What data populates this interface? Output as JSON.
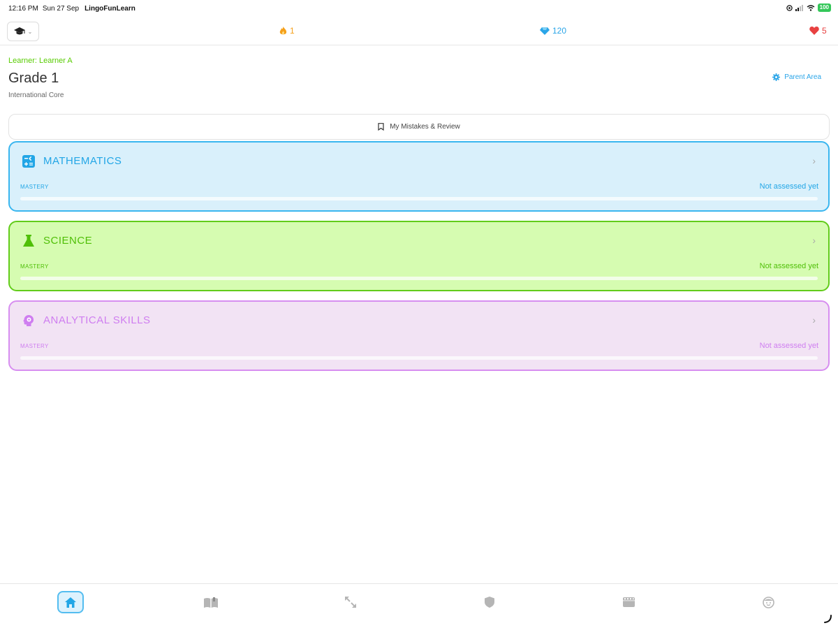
{
  "status_bar": {
    "time": "12:16 PM",
    "date": "Sun 27 Sep",
    "app_name": "LingoFunLearn",
    "battery": "100"
  },
  "top_bar": {
    "grade_icon": "graduation-cap-icon",
    "streak": "1",
    "gems": "120",
    "hearts": "5",
    "colors": {
      "streak": "#f5a01a",
      "gems": "#2aa5e8",
      "hearts": "#e84141"
    }
  },
  "header": {
    "learner": "Learner: Learner A",
    "grade": "Grade 1",
    "curriculum": "International Core",
    "parent_area": "Parent Area"
  },
  "review": {
    "label": "My Mistakes & Review"
  },
  "subjects": [
    {
      "title": "MATHEMATICS",
      "icon": "calculator-icon",
      "mastery_label": "MASTERY",
      "status": "Not assessed yet",
      "mastery_percent": 0,
      "color": "#22a6e6"
    },
    {
      "title": "SCIENCE",
      "icon": "flask-icon",
      "mastery_label": "MASTERY",
      "status": "Not assessed yet",
      "mastery_percent": 0,
      "color": "#4fbf07"
    },
    {
      "title": "ANALYTICAL SKILLS",
      "icon": "brain-head-icon",
      "mastery_label": "MASTERY",
      "status": "Not assessed yet",
      "mastery_percent": 0,
      "color": "#cf7ef0"
    }
  ],
  "bottom_nav": {
    "items": [
      {
        "icon": "home-icon",
        "active": true
      },
      {
        "icon": "book-icon",
        "active": false
      },
      {
        "icon": "expand-arrows-icon",
        "active": false
      },
      {
        "icon": "shield-icon",
        "active": false
      },
      {
        "icon": "film-icon",
        "active": false
      },
      {
        "icon": "face-icon",
        "active": false
      }
    ]
  }
}
